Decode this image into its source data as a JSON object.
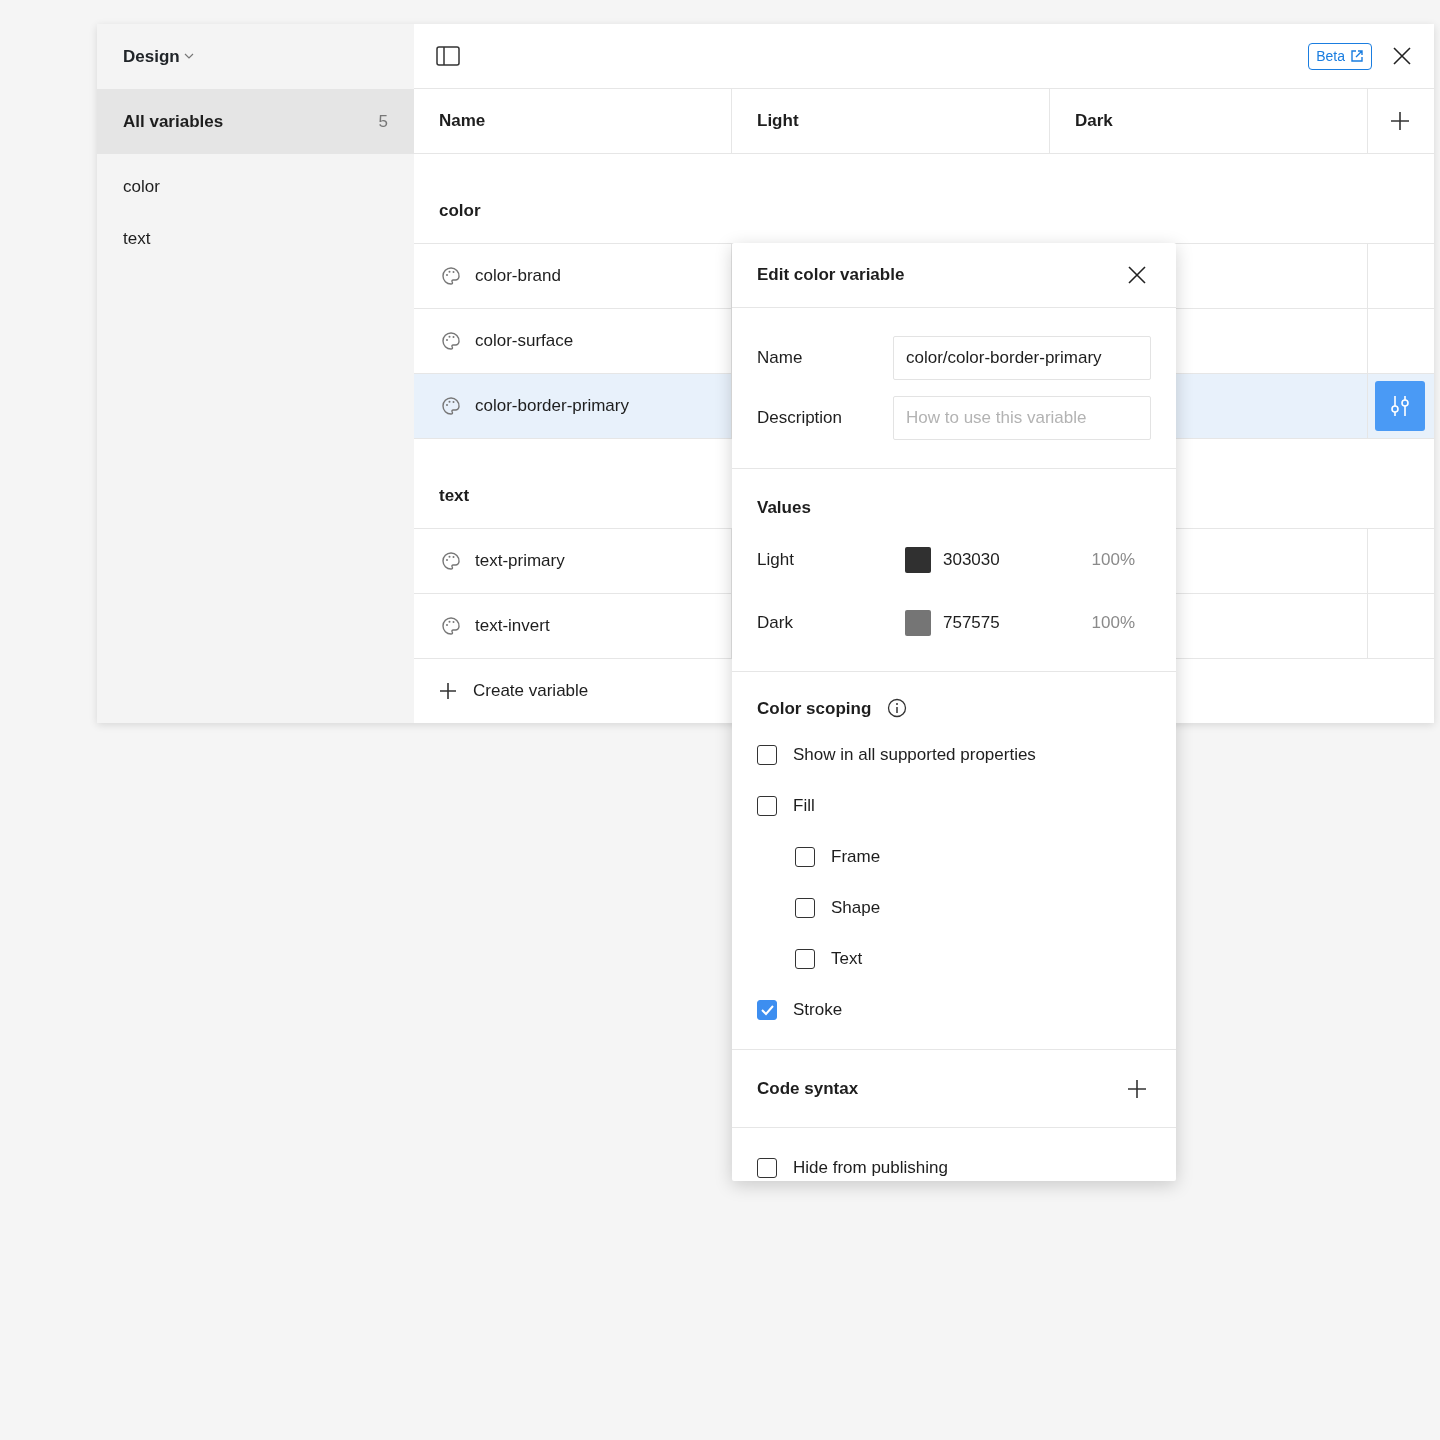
{
  "sidebar": {
    "title": "Design",
    "items": [
      {
        "label": "All variables",
        "count": "5",
        "selected": true
      },
      {
        "label": "color",
        "selected": false
      },
      {
        "label": "text",
        "selected": false
      }
    ]
  },
  "toolbar": {
    "beta_label": "Beta"
  },
  "table": {
    "columns": [
      "Name",
      "Light",
      "Dark"
    ],
    "groups": [
      {
        "name": "color",
        "rows": [
          {
            "name": "color-brand",
            "selected": false
          },
          {
            "name": "color-surface",
            "selected": false
          },
          {
            "name": "color-border-primary",
            "selected": true
          }
        ]
      },
      {
        "name": "text",
        "rows": [
          {
            "name": "text-primary",
            "selected": false
          },
          {
            "name": "text-invert",
            "selected": false
          }
        ]
      }
    ],
    "create_label": "Create variable"
  },
  "editor": {
    "title": "Edit color variable",
    "fields": [
      {
        "label": "Name",
        "value": "color/color-border-primary"
      },
      {
        "label": "Description",
        "placeholder": "How to use this variable"
      }
    ],
    "values_title": "Values",
    "values": [
      {
        "mode": "Light",
        "color": "#303030",
        "hex": "303030",
        "opacity": "100%"
      },
      {
        "mode": "Dark",
        "color": "#757575",
        "hex": "757575",
        "opacity": "100%"
      }
    ],
    "scoping_title": "Color scoping",
    "scopes": [
      {
        "label": "Show in all supported properties",
        "checked": false
      },
      {
        "label": "Fill",
        "checked": false,
        "children": [
          {
            "label": "Frame",
            "checked": false
          },
          {
            "label": "Shape",
            "checked": false
          },
          {
            "label": "Text",
            "checked": false
          }
        ]
      },
      {
        "label": "Stroke",
        "checked": true
      }
    ],
    "code_syntax_title": "Code syntax",
    "publishing": {
      "label": "Hide from publishing",
      "checked": false
    }
  }
}
